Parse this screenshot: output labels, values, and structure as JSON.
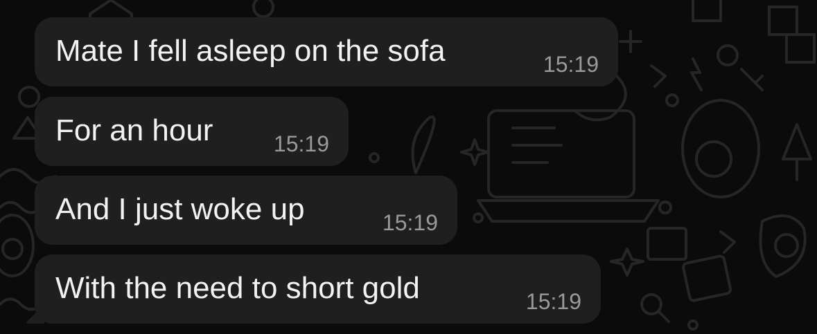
{
  "conversation": {
    "messages": [
      {
        "text": "Mate I fell asleep on the sofa",
        "time": "15:19"
      },
      {
        "text": "For an hour",
        "time": "15:19"
      },
      {
        "text": "And I just woke up",
        "time": "15:19"
      },
      {
        "text": "With the need to short gold",
        "time": "15:19"
      }
    ]
  },
  "theme": {
    "background": "#0b0b0b",
    "bubble": "#1f1f1f",
    "text": "#f2f2f2",
    "timestamp": "#9a9a9a",
    "doodle": "#262626"
  }
}
